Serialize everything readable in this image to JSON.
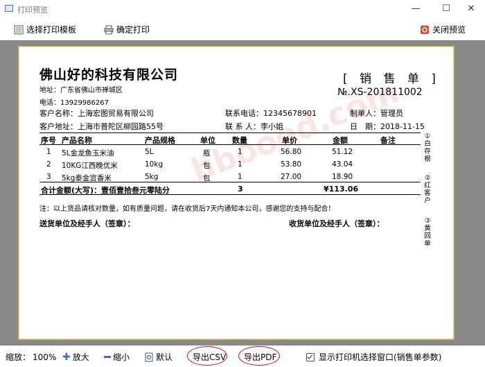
{
  "window": {
    "title": "打印预览",
    "minimize": "—",
    "maximize": "☐",
    "close": "✕"
  },
  "toolbar": {
    "choose_template": "选择打印模板",
    "confirm_print": "确定打印",
    "close_preview": "关闭预览"
  },
  "document": {
    "company": "佛山好的科技有限公司",
    "address": "地址：广东省佛山市禅城区",
    "phone": "电话：13929986267",
    "title": "[ 销 售 单 ]",
    "number": "№.XS-201811002",
    "customer_name_label": "客户名称：",
    "customer_name": "上海宏图贸易有限公司",
    "contact_phone_label": "联系电话：",
    "contact_phone": "12345678901",
    "maker_label": "制单人：",
    "maker": "管理员",
    "customer_addr_label": "客户地址：",
    "customer_addr": "上海市普陀区柳园路55号",
    "contact_label": "联 系 人：",
    "contact": "李小姐",
    "date_label": "日　期：",
    "date": "2018-11-15",
    "headers": {
      "seq": "序号",
      "name": "产品名称",
      "spec": "产品规格",
      "unit": "单位",
      "qty": "数量",
      "price": "单价",
      "amount": "金额",
      "remark": "备注"
    },
    "rows": [
      {
        "seq": "1",
        "name": "5L金龙鱼玉米油",
        "spec": "5L",
        "unit": "瓶",
        "qty": "1",
        "price": "56.80",
        "amount": "51.12"
      },
      {
        "seq": "2",
        "name": "10KG江西晚优米",
        "spec": "10kg",
        "unit": "包",
        "qty": "1",
        "price": "53.80",
        "amount": "43.04"
      },
      {
        "seq": "3",
        "name": "5kg泰金宫香米",
        "spec": "5kg",
        "unit": "包",
        "qty": "1",
        "price": "27.00",
        "amount": "18.90"
      }
    ],
    "total_label": "合计金额(大写)：壹佰壹拾叁元零陆分",
    "total_qty": "3",
    "total_amount": "¥113.06",
    "note": "注：以上货品请核对数量，如有质量问题，请在收货后7天内通知本公司，感谢您的支持与配合！",
    "sender_sign": "送货单位及经手人（签章）：",
    "receiver_sign": "收货单位及经手人（签章）：",
    "side_copies": [
      "①白存根",
      "②红客户",
      "③黄回单"
    ],
    "watermark": "hbooed.com"
  },
  "statusbar": {
    "zoom_label": "缩放：",
    "zoom_value": "100%",
    "zoom_in": "放大",
    "zoom_out": "缩小",
    "default": "默认",
    "export_csv": "导出CSV",
    "export_pdf": "导出PDF",
    "show_printer_dialog": "显示打印机选择窗口(销售单参数)"
  },
  "colors": {
    "preview_bg": "#898989",
    "paper_border": "#c9a645",
    "highlight_circle": "#e00000"
  }
}
